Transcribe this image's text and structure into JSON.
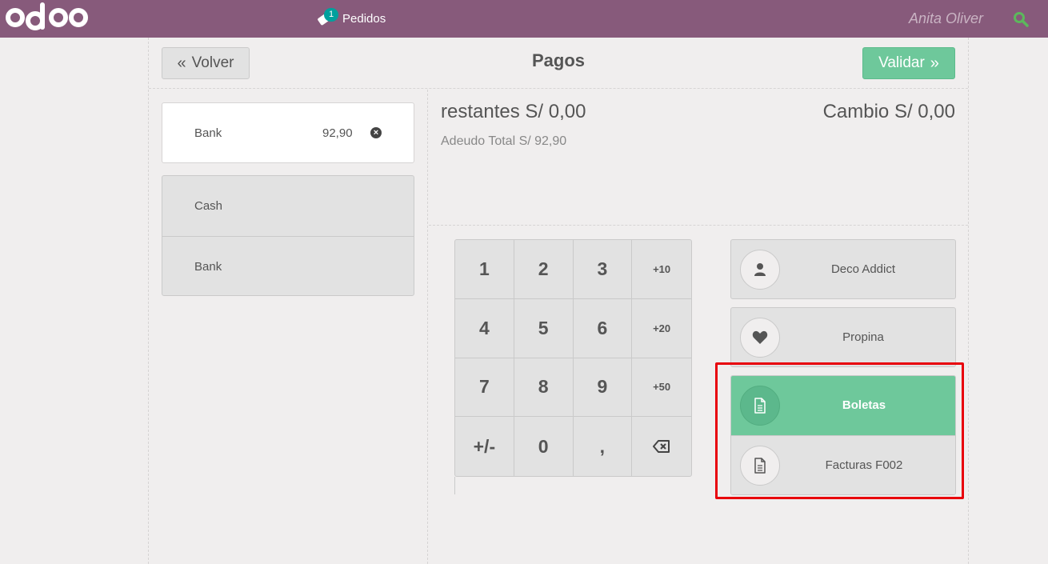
{
  "topbar": {
    "orders_count": "1",
    "orders_label": "Pedidos",
    "username": "Anita Oliver",
    "colors": {
      "bar": "#875a7b",
      "search": "#5cb85c",
      "badge": "#00a09d"
    }
  },
  "header": {
    "back_label": "Volver",
    "title": "Pagos",
    "validate_label": "Validar"
  },
  "paymentline": {
    "name": "Bank",
    "amount": "92,90"
  },
  "payment_methods": [
    {
      "label": "Cash"
    },
    {
      "label": "Bank"
    }
  ],
  "summary": {
    "remaining": "restantes S/ 0,00",
    "change": "Cambio S/ 0,00",
    "total_due": "Adeudo Total  S/ 92,90"
  },
  "numpad": {
    "keys": [
      "1",
      "2",
      "3",
      "+10",
      "4",
      "5",
      "6",
      "+20",
      "7",
      "8",
      "9",
      "+50",
      "+/-",
      "0",
      ",",
      "⌫"
    ]
  },
  "actions": {
    "customer": {
      "label": "Deco Addict",
      "icon": "user-icon"
    },
    "tip": {
      "label": "Propina",
      "icon": "heart-icon"
    },
    "boletas": {
      "label": "Boletas",
      "icon": "document-icon"
    },
    "facturas": {
      "label": "Facturas F002",
      "icon": "document-icon"
    }
  },
  "colors": {
    "accent_green": "#6ec89b",
    "highlight_border": "#e8000b"
  }
}
